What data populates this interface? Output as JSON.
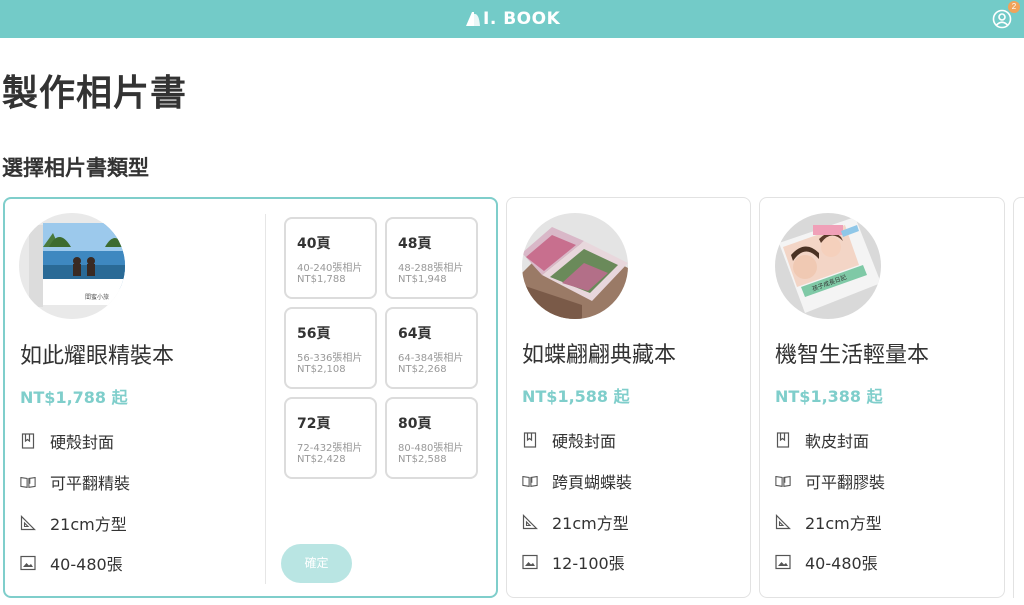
{
  "header": {
    "logo_text": "I. BOOK",
    "notification_count": "2",
    "brand_color": "#73cbc8",
    "accent_color": "#7fcecb",
    "icons": {
      "logo": "book-logo-icon",
      "user": "user-circle-icon"
    }
  },
  "page": {
    "title": "製作相片書",
    "section_title": "選擇相片書類型"
  },
  "products": [
    {
      "name": "如此耀眼精裝本",
      "price": "NT$1,788 起",
      "selected": true,
      "thumb_caption": "閨蜜小旅",
      "features": [
        {
          "icon": "bookmark-icon",
          "text": "硬殼封面"
        },
        {
          "icon": "open-book-icon",
          "text": "可平翻精裝"
        },
        {
          "icon": "set-square-icon",
          "text": "21cm方型"
        },
        {
          "icon": "image-icon",
          "text": "40-480張"
        }
      ],
      "page_options": [
        {
          "pages": "40頁",
          "range": "40-240張相片",
          "price": "NT$1,788"
        },
        {
          "pages": "48頁",
          "range": "48-288張相片",
          "price": "NT$1,948"
        },
        {
          "pages": "56頁",
          "range": "56-336張相片",
          "price": "NT$2,108"
        },
        {
          "pages": "64頁",
          "range": "64-384張相片",
          "price": "NT$2,268"
        },
        {
          "pages": "72頁",
          "range": "72-432張相片",
          "price": "NT$2,428"
        },
        {
          "pages": "80頁",
          "range": "80-480張相片",
          "price": "NT$2,588"
        }
      ],
      "confirm_label": "確定"
    },
    {
      "name": "如蝶翩翩典藏本",
      "price": "NT$1,588 起",
      "selected": false,
      "features": [
        {
          "icon": "bookmark-icon",
          "text": "硬殼封面"
        },
        {
          "icon": "open-book-icon",
          "text": "跨頁蝴蝶裝"
        },
        {
          "icon": "set-square-icon",
          "text": "21cm方型"
        },
        {
          "icon": "image-icon",
          "text": "12-100張"
        }
      ]
    },
    {
      "name": "機智生活輕量本",
      "price": "NT$1,388 起",
      "selected": false,
      "thumb_caption": "孩子成長日記",
      "features": [
        {
          "icon": "bookmark-icon",
          "text": "軟皮封面"
        },
        {
          "icon": "open-book-icon",
          "text": "可平翻膠裝"
        },
        {
          "icon": "set-square-icon",
          "text": "21cm方型"
        },
        {
          "icon": "image-icon",
          "text": "40-480張"
        }
      ]
    }
  ]
}
